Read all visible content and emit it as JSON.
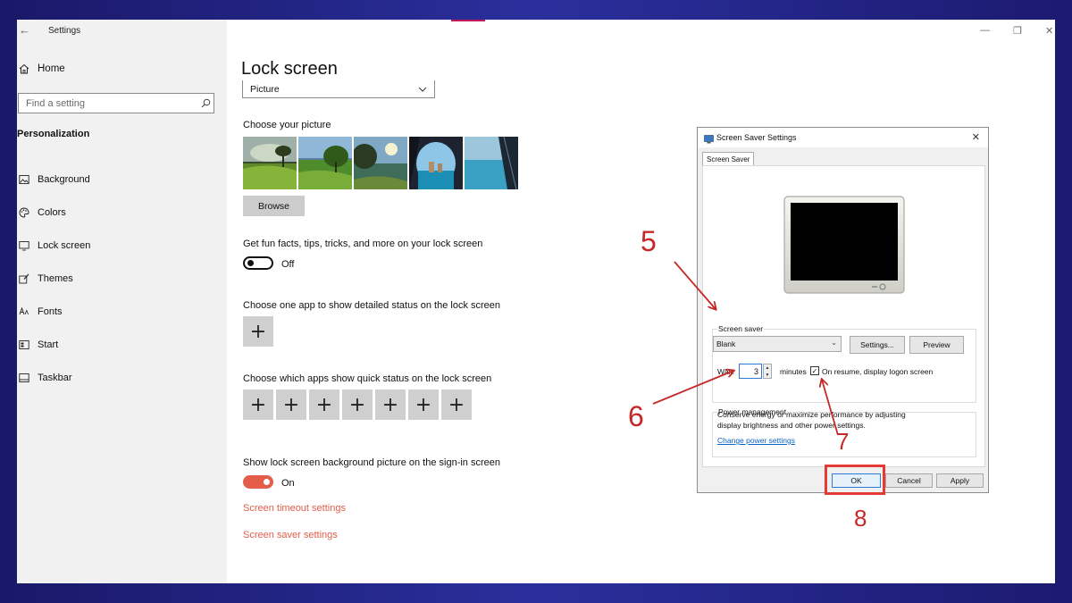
{
  "window": {
    "app_title": "Settings",
    "home_label": "Home",
    "search_placeholder": "Find a setting",
    "section_title": "Personalization"
  },
  "sidebar": {
    "items": [
      {
        "label": "Background",
        "icon": "image-icon"
      },
      {
        "label": "Colors",
        "icon": "palette-icon"
      },
      {
        "label": "Lock screen",
        "icon": "monitor-lock-icon"
      },
      {
        "label": "Themes",
        "icon": "brush-icon"
      },
      {
        "label": "Fonts",
        "icon": "fonts-icon"
      },
      {
        "label": "Start",
        "icon": "start-icon"
      },
      {
        "label": "Taskbar",
        "icon": "taskbar-icon"
      }
    ]
  },
  "main": {
    "title": "Lock screen",
    "background_select": "Picture",
    "choose_picture_label": "Choose your picture",
    "browse_label": "Browse",
    "fun_facts_label": "Get fun facts, tips, tricks, and more on your lock screen",
    "fun_facts_state": "Off",
    "detailed_status_label": "Choose one app to show detailed status on the lock screen",
    "quick_status_label": "Choose which apps show quick status on the lock screen",
    "quick_status_slots": 7,
    "signin_bg_label": "Show lock screen background picture on the sign-in screen",
    "signin_bg_state": "On",
    "timeout_link": "Screen timeout settings",
    "saver_link": "Screen saver settings",
    "accent_color": "#e35d4a"
  },
  "dialog": {
    "title": "Screen Saver Settings",
    "tab": "Screen Saver",
    "group_screen_saver": "Screen saver",
    "saver_value": "Blank",
    "settings_btn": "Settings...",
    "preview_btn": "Preview",
    "wait_label": "Wait:",
    "wait_value": "3",
    "minutes_label": "minutes",
    "resume_label": "On resume, display logon screen",
    "resume_checked": true,
    "group_power": "Power management",
    "power_text_1": "Conserve energy or maximize performance by adjusting",
    "power_text_2": "display brightness and other power settings.",
    "power_link": "Change power settings",
    "ok_btn": "OK",
    "cancel_btn": "Cancel",
    "apply_btn": "Apply"
  },
  "annotations": {
    "step5": "5",
    "step6": "6",
    "step7": "7",
    "step8": "8",
    "color": "#c62828"
  }
}
